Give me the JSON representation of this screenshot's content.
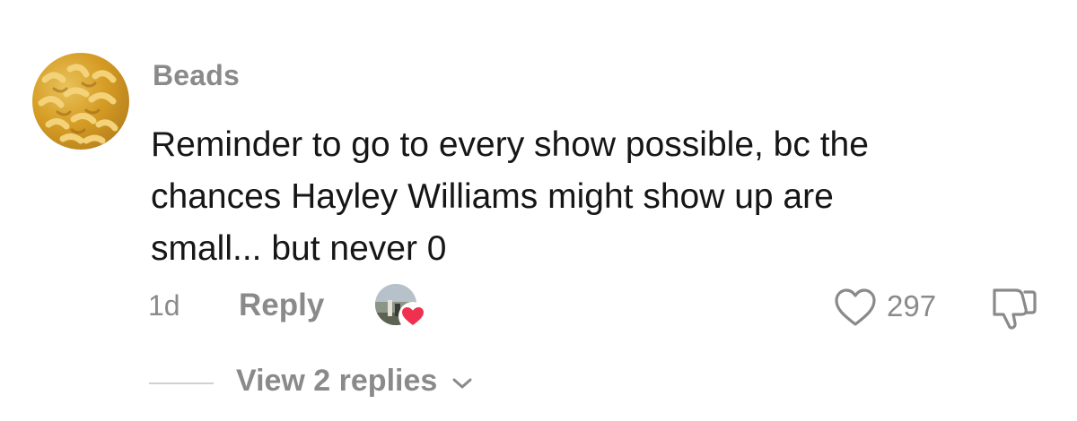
{
  "comment": {
    "username": "Beads",
    "text_lines": [
      "Reminder to go to every show possible, bc the",
      "chances Hayley Williams might show up are",
      "small... but never 0"
    ],
    "time": "1d",
    "reply_label": "Reply",
    "like_count": "297",
    "view_replies_label": "View 2 replies"
  },
  "icons": {
    "avatar": "mac-and-cheese-avatar",
    "creator_like": "creator-liked-heart-icon",
    "like": "heart-outline-icon",
    "dislike": "thumbs-down-icon",
    "expand": "chevron-down-icon"
  },
  "colors": {
    "text_primary": "#161616",
    "text_secondary": "#8a8a8a",
    "heart_red": "#f0304f"
  }
}
